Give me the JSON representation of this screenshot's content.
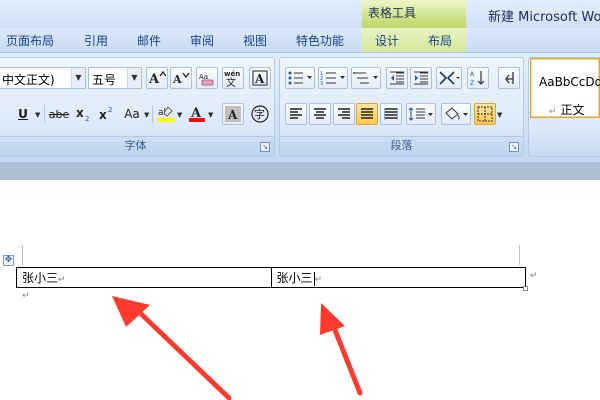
{
  "titlebar": {
    "context_tab": "表格工具",
    "doc_title": "新建 Microsoft Wo"
  },
  "tabs": [
    {
      "label": "页面布局"
    },
    {
      "label": "引用"
    },
    {
      "label": "邮件"
    },
    {
      "label": "审阅"
    },
    {
      "label": "视图"
    },
    {
      "label": "特色功能"
    },
    {
      "label": "设计"
    },
    {
      "label": "布局"
    }
  ],
  "font_group": {
    "font_name": "中文正文)",
    "font_size": "五号",
    "label": "字体",
    "buttons": {
      "grow": "A",
      "shrink": "A",
      "clear": "Aa",
      "phonetic": "wén",
      "border_char": "A",
      "underline": "U",
      "strike": "abe",
      "subscript": "x",
      "superscript": "x",
      "change_case": "Aa",
      "highlight": "ab",
      "font_color": "A",
      "char_shading": "A",
      "enclose": "字"
    }
  },
  "paragraph_group": {
    "label": "段落"
  },
  "styles_group": {
    "preview": "AaBbCcDd",
    "style_name": "正文"
  },
  "document": {
    "table": {
      "cells": [
        "张小三",
        "张小三"
      ]
    }
  },
  "colors": {
    "highlight": "#ffff00",
    "font_color": "#ff0000",
    "annotation_arrow": "#ff3b30"
  },
  "icons": {
    "paragraph_mark": "↵",
    "table_move_handle": "✥"
  }
}
